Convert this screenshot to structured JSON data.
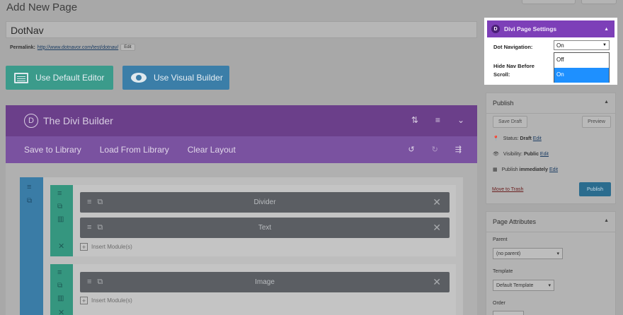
{
  "page": {
    "title": "Add New Page"
  },
  "post": {
    "title_value": "DotNav",
    "permalink_label": "Permalink:",
    "permalink_url": "http://www.dotnavor.com/test/dotnav/",
    "edit_label": "Edit"
  },
  "editor_buttons": {
    "default": "Use Default Editor",
    "visual": "Use Visual Builder"
  },
  "builder": {
    "logo_letter": "D",
    "title": "The Divi Builder",
    "toolbar": [
      "Save to Library",
      "Load From Library",
      "Clear Layout"
    ],
    "insert_label": "Insert Module(s)",
    "modules": [
      "Divider",
      "Text",
      "Image"
    ]
  },
  "divi_settings": {
    "logo_letter": "D",
    "title": "Divi Page Settings",
    "dot_nav_label": "Dot Navigation:",
    "dot_nav_value": "On",
    "hide_nav_label_1": "Hide Nav Before",
    "hide_nav_label_2": "Scroll:",
    "options": [
      "Off",
      "On"
    ],
    "selected_option": "On"
  },
  "publish": {
    "title": "Publish",
    "save_draft": "Save Draft",
    "preview": "Preview",
    "status_label": "Status:",
    "status_value": "Draft",
    "visibility_label": "Visibility:",
    "visibility_value": "Public",
    "publish_label": "Publish",
    "publish_value": "immediately",
    "edit": "Edit",
    "trash": "Move to Trash",
    "publish_button": "Publish"
  },
  "attributes": {
    "title": "Page Attributes",
    "parent_label": "Parent",
    "parent_value": "(no parent)",
    "template_label": "Template",
    "template_value": "Default Template",
    "order_label": "Order"
  },
  "colors": {
    "divi_purple": "#7d3fb8",
    "selected_blue": "#1e90ff",
    "publish_blue": "#2b6c8e"
  }
}
